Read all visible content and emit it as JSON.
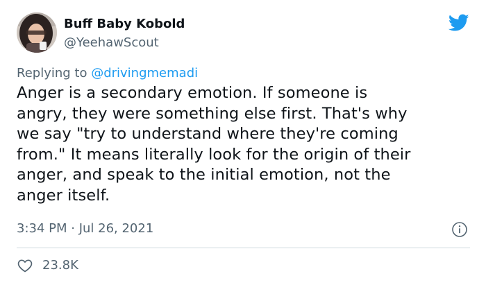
{
  "tweet": {
    "author": {
      "display_name": "Buff Baby Kobold",
      "handle": "@YeehawScout",
      "avatar_icon": "profile-photo"
    },
    "reply": {
      "prefix": "Replying to ",
      "mention": "@drivingmemadi"
    },
    "body_lines": [
      "Anger is a secondary emotion. If someone is",
      "angry, they were something else first. That's why",
      "we say \"try to understand where they're coming",
      "from.\" It means literally look for the origin of their",
      "anger, and speak to the initial emotion, not the",
      "anger itself."
    ],
    "timestamp": "3:34 PM · Jul 26, 2021",
    "likes": "23.8K"
  },
  "icons": {
    "brand": "twitter-bird-icon",
    "info": "info-icon",
    "like": "heart-icon"
  },
  "colors": {
    "accent": "#1d9bf0",
    "text": "#0f1419",
    "secondary_text": "#536471",
    "divider": "#cfd9de"
  }
}
